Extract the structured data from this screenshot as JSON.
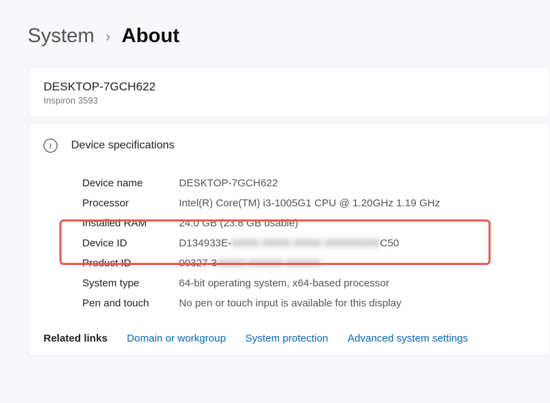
{
  "breadcrumb": {
    "parent": "System",
    "separator": "›",
    "current": "About"
  },
  "device_card": {
    "name": "DESKTOP-7GCH622",
    "model": "Inspiron 3593"
  },
  "specs": {
    "title": "Device specifications",
    "rows": [
      {
        "label": "Device name",
        "value": "DESKTOP-7GCH622"
      },
      {
        "label": "Processor",
        "value": "Intel(R) Core(TM) i3-1005G1 CPU @ 1.20GHz   1.19 GHz"
      },
      {
        "label": "Installed RAM",
        "value": "24.0 GB (23.8 GB usable)"
      },
      {
        "label": "Device ID",
        "value_prefix": "D134933E-",
        "value_blur": "XXXX-XXXX-XXXX-XXXXXXXX",
        "value_suffix": "C50"
      },
      {
        "label": "Product ID",
        "value_prefix": "00327-3",
        "value_blur": "XXXX-XXXXX-XXXXX"
      },
      {
        "label": "System type",
        "value": "64-bit operating system, x64-based processor"
      },
      {
        "label": "Pen and touch",
        "value": "No pen or touch input is available for this display"
      }
    ]
  },
  "related": {
    "label": "Related links",
    "links": [
      "Domain or workgroup",
      "System protection",
      "Advanced system settings"
    ]
  }
}
